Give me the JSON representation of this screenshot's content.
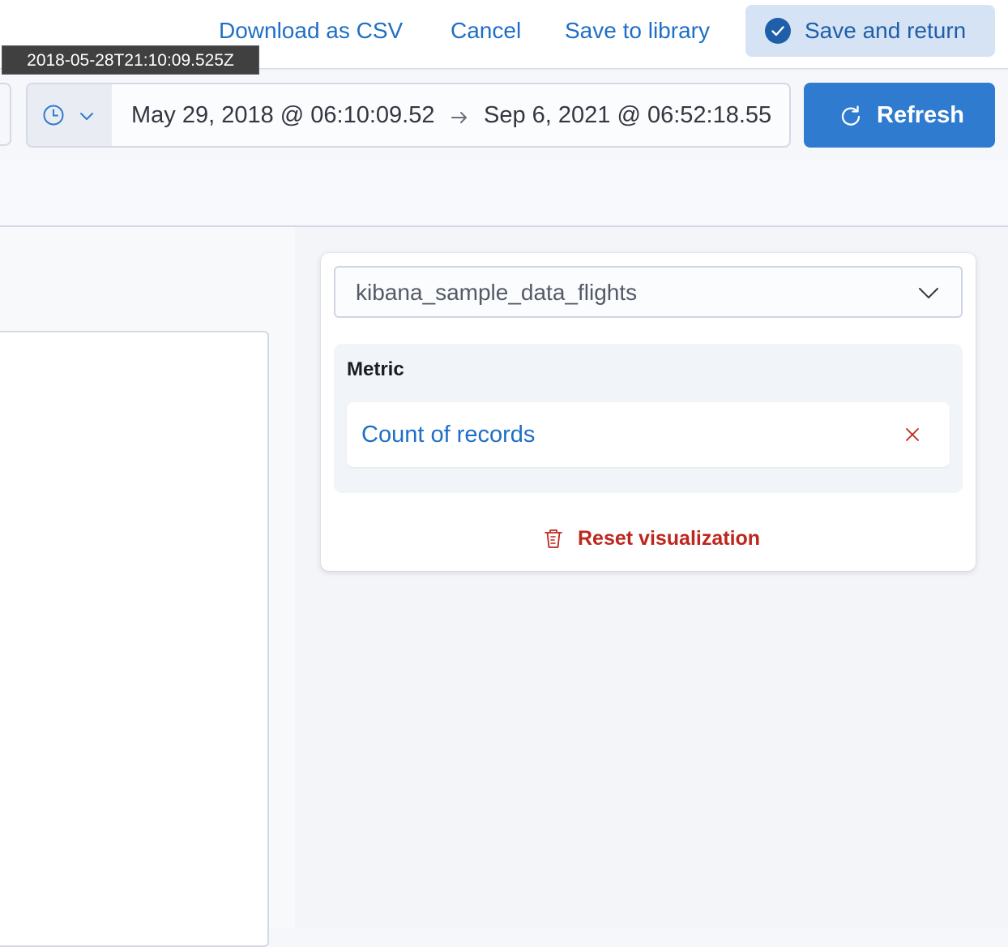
{
  "header": {
    "download_csv": "Download as CSV",
    "cancel": "Cancel",
    "save_to_library": "Save to library",
    "save_and_return": "Save and return"
  },
  "tooltip": {
    "text": "2018-05-28T21:10:09.525Z"
  },
  "date_picker": {
    "start": "May 29, 2018 @ 06:10:09.52",
    "end": "Sep 6, 2021 @ 06:52:18.55",
    "quick_menu_icons": [
      "clock-icon",
      "chevron-down-icon"
    ],
    "arrow_icon": "arrow-right-icon"
  },
  "refresh": {
    "label": "Refresh",
    "icon": "refresh-icon"
  },
  "config_panel": {
    "datasource": "kibana_sample_data_flights",
    "metric_group_title": "Metric",
    "metric_dimension": "Count of records",
    "reset_label": "Reset visualization"
  },
  "colors": {
    "link": "#1f6fc5",
    "primary_button": "#2f7bcf",
    "save_button_bg": "#d5e3f5",
    "danger": "#bd271e",
    "border": "#d3dae6"
  }
}
